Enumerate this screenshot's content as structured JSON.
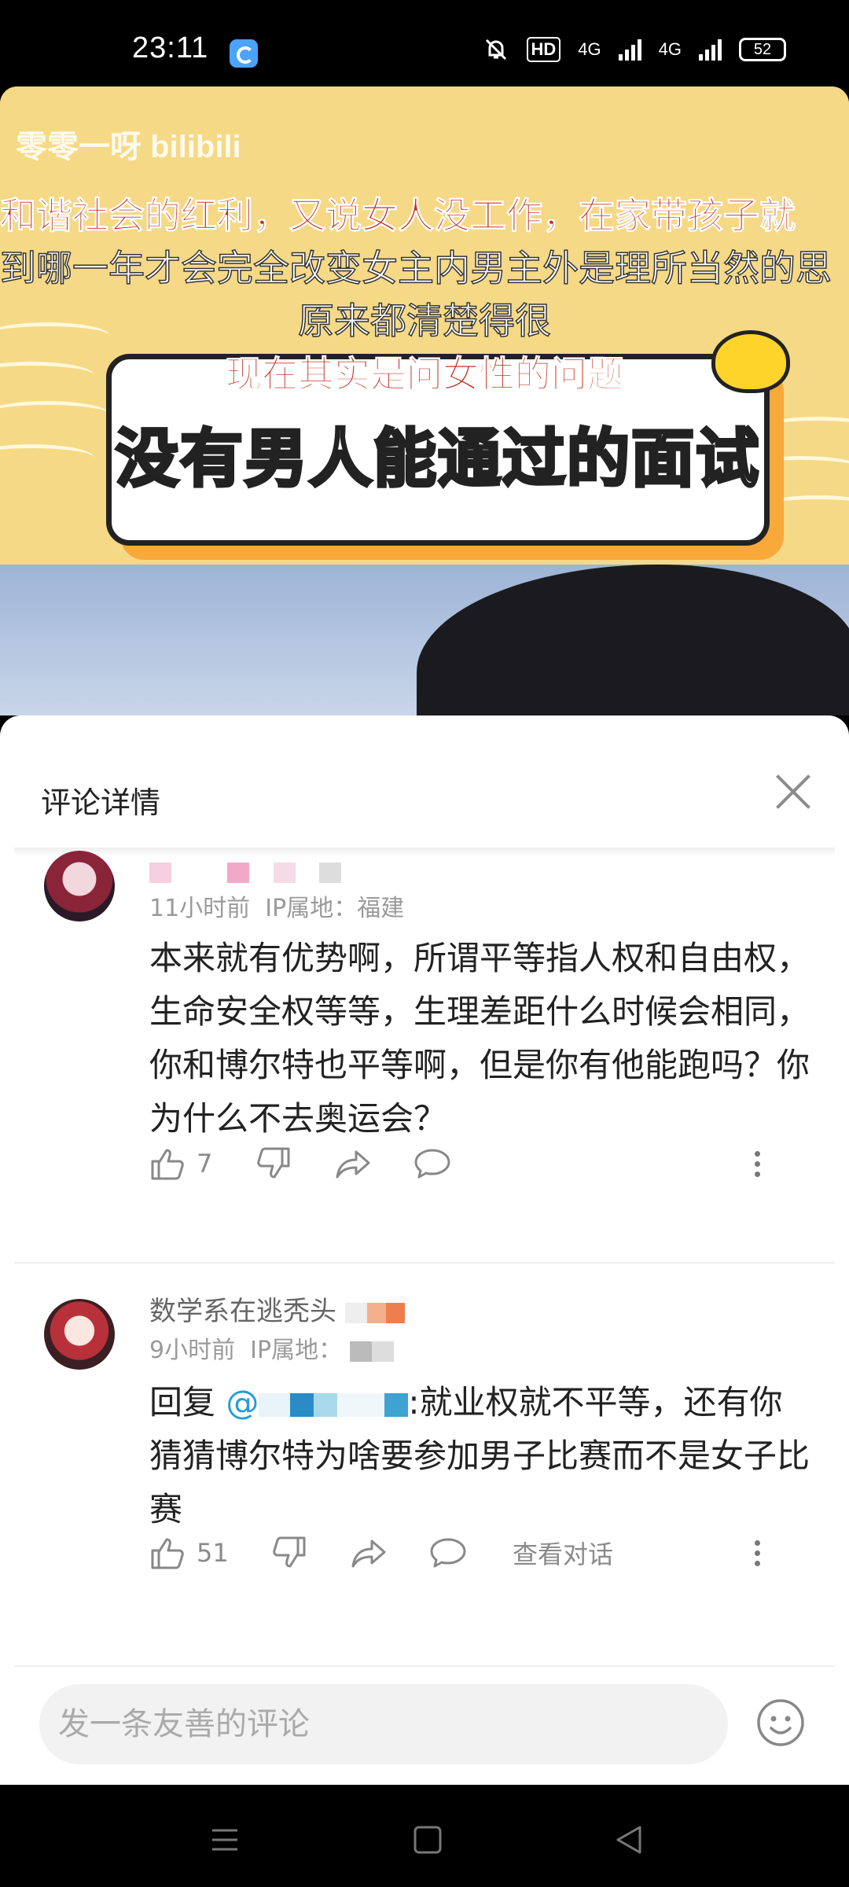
{
  "status_bar": {
    "time": "23:11",
    "hd_label": "HD",
    "network_1": "4G",
    "network_2": "4G",
    "battery": "52"
  },
  "video": {
    "watermark": "零零一呀 bilibili",
    "subtitle_red_1": "和谐社会的红利，又说女人没工作，在家带孩子就",
    "subtitle_white_1": "到哪一年才会完全改变女主内男主外是理所当然的思",
    "subtitle_white_2": "原来都清楚得很",
    "subtitle_red_2": "现在其实是问女性的问题",
    "board_title": "没有男人能通过的面试"
  },
  "sheet": {
    "title": "评论详情"
  },
  "comments": [
    {
      "time": "11小时前",
      "ip": "IP属地：福建",
      "text": "本来就有优势啊，所谓平等指人权和自由权，生命安全权等等，生理差距什么时候会相同，你和博尔特也平等啊，但是你有他能跑吗？你为什么不去奥运会？",
      "likes": "7"
    },
    {
      "username": "数学系在逃秃头",
      "time": "9小时前",
      "ip": "IP属地：",
      "reply_prefix": "回复 ",
      "mention": "@",
      "text": ":就业权就不平等，还有你猜猜博尔特为啥要参加男子比赛而不是女子比赛",
      "likes": "51",
      "view_conversation": "查看对话"
    }
  ],
  "input": {
    "placeholder": "发一条友善的评论"
  },
  "colors": {
    "accent": "#2a9ad8",
    "subtitle_red": "#c22e1f",
    "cover_yellow": "#f6d986"
  }
}
